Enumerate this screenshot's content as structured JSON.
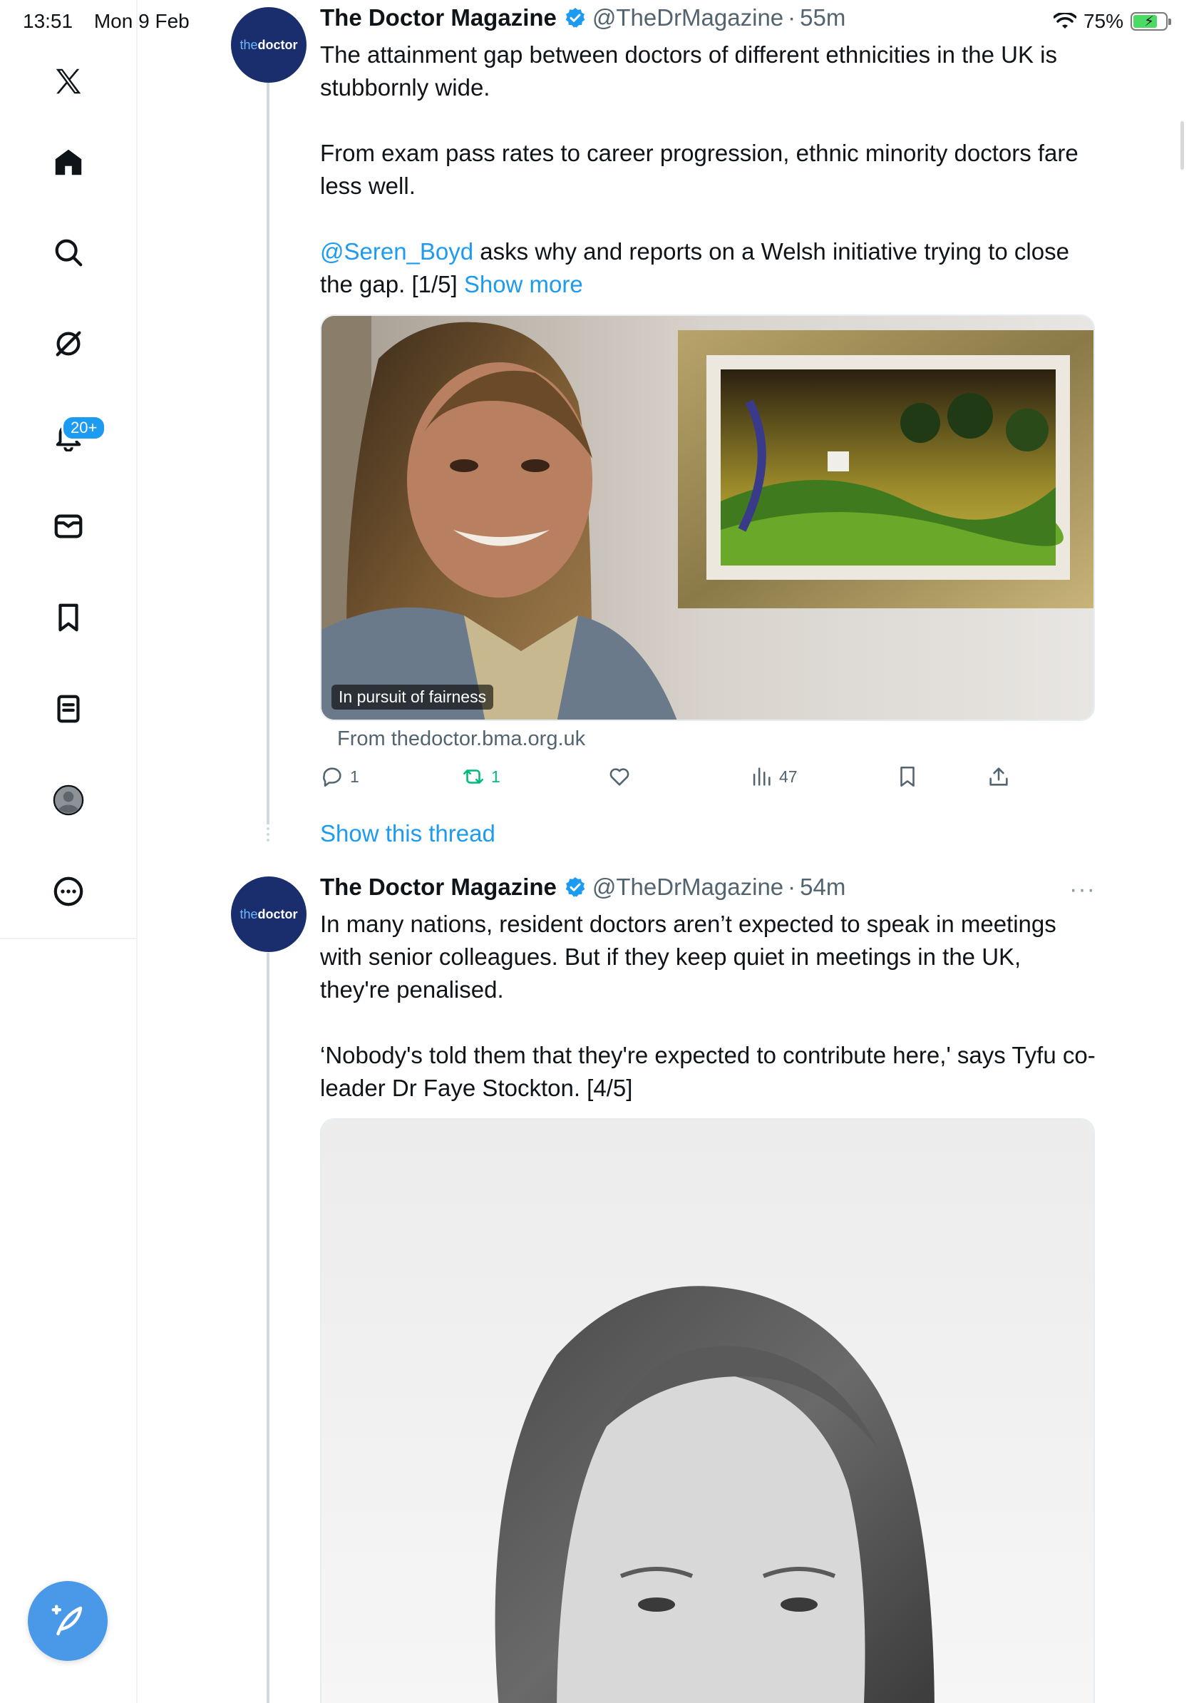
{
  "status_bar": {
    "time": "13:51",
    "date": "Mon 9 Feb",
    "battery_percent": "75%",
    "battery_level": 0.75
  },
  "sidebar": {
    "items": [
      {
        "name": "x-logo-icon"
      },
      {
        "name": "home-icon"
      },
      {
        "name": "search-icon"
      },
      {
        "name": "grok-icon"
      },
      {
        "name": "notifications-bell-icon"
      },
      {
        "name": "messages-icon"
      },
      {
        "name": "bookmarks-icon"
      },
      {
        "name": "lists-icon"
      },
      {
        "name": "profile-icon"
      },
      {
        "name": "more-icon"
      }
    ],
    "notifications_badge": "20+",
    "compose_icon": "compose-feather-icon"
  },
  "colors": {
    "accent": "#1d9bf0",
    "avatar_bg": "#1a2e6e",
    "fab": "#4a99e9",
    "muted": "#536471",
    "retweet": "#00ba7c"
  },
  "tweets": [
    {
      "avatar_text_a": "the",
      "avatar_text_b": "doctor",
      "author": "The Doctor Magazine",
      "handle": "@TheDrMagazine",
      "separator": "·",
      "time": "55m",
      "paragraph1": "The attainment gap between doctors of different ethnicities in the UK is stubbornly wide.",
      "paragraph2": "From exam pass rates to career progression, ethnic minority doctors fare less well.",
      "mention": "@Seren_Boyd",
      "paragraph3_rest": " asks why and reports on a Welsh initiative trying to close the gap. [1/5] ",
      "show_more": "Show more",
      "media_caption": "In pursuit of fairness",
      "source": "From thedoctor.bma.org.uk",
      "replies": "1",
      "reposts": "1",
      "likes": "",
      "views": "47"
    },
    {
      "avatar_text_a": "the",
      "avatar_text_b": "doctor",
      "author": "The Doctor Magazine",
      "handle": "@TheDrMagazine",
      "separator": "·",
      "time": "54m",
      "paragraph1": "In many nations, resident doctors aren’t expected to speak in meetings with senior colleagues. But if they keep quiet in meetings in the UK, they're penalised.",
      "paragraph2": "‘Nobody's told them that they're expected to contribute here,' says Tyfu co-leader Dr Faye Stockton. [4/5]",
      "more_menu": "···"
    }
  ],
  "show_this_thread": "Show this thread"
}
